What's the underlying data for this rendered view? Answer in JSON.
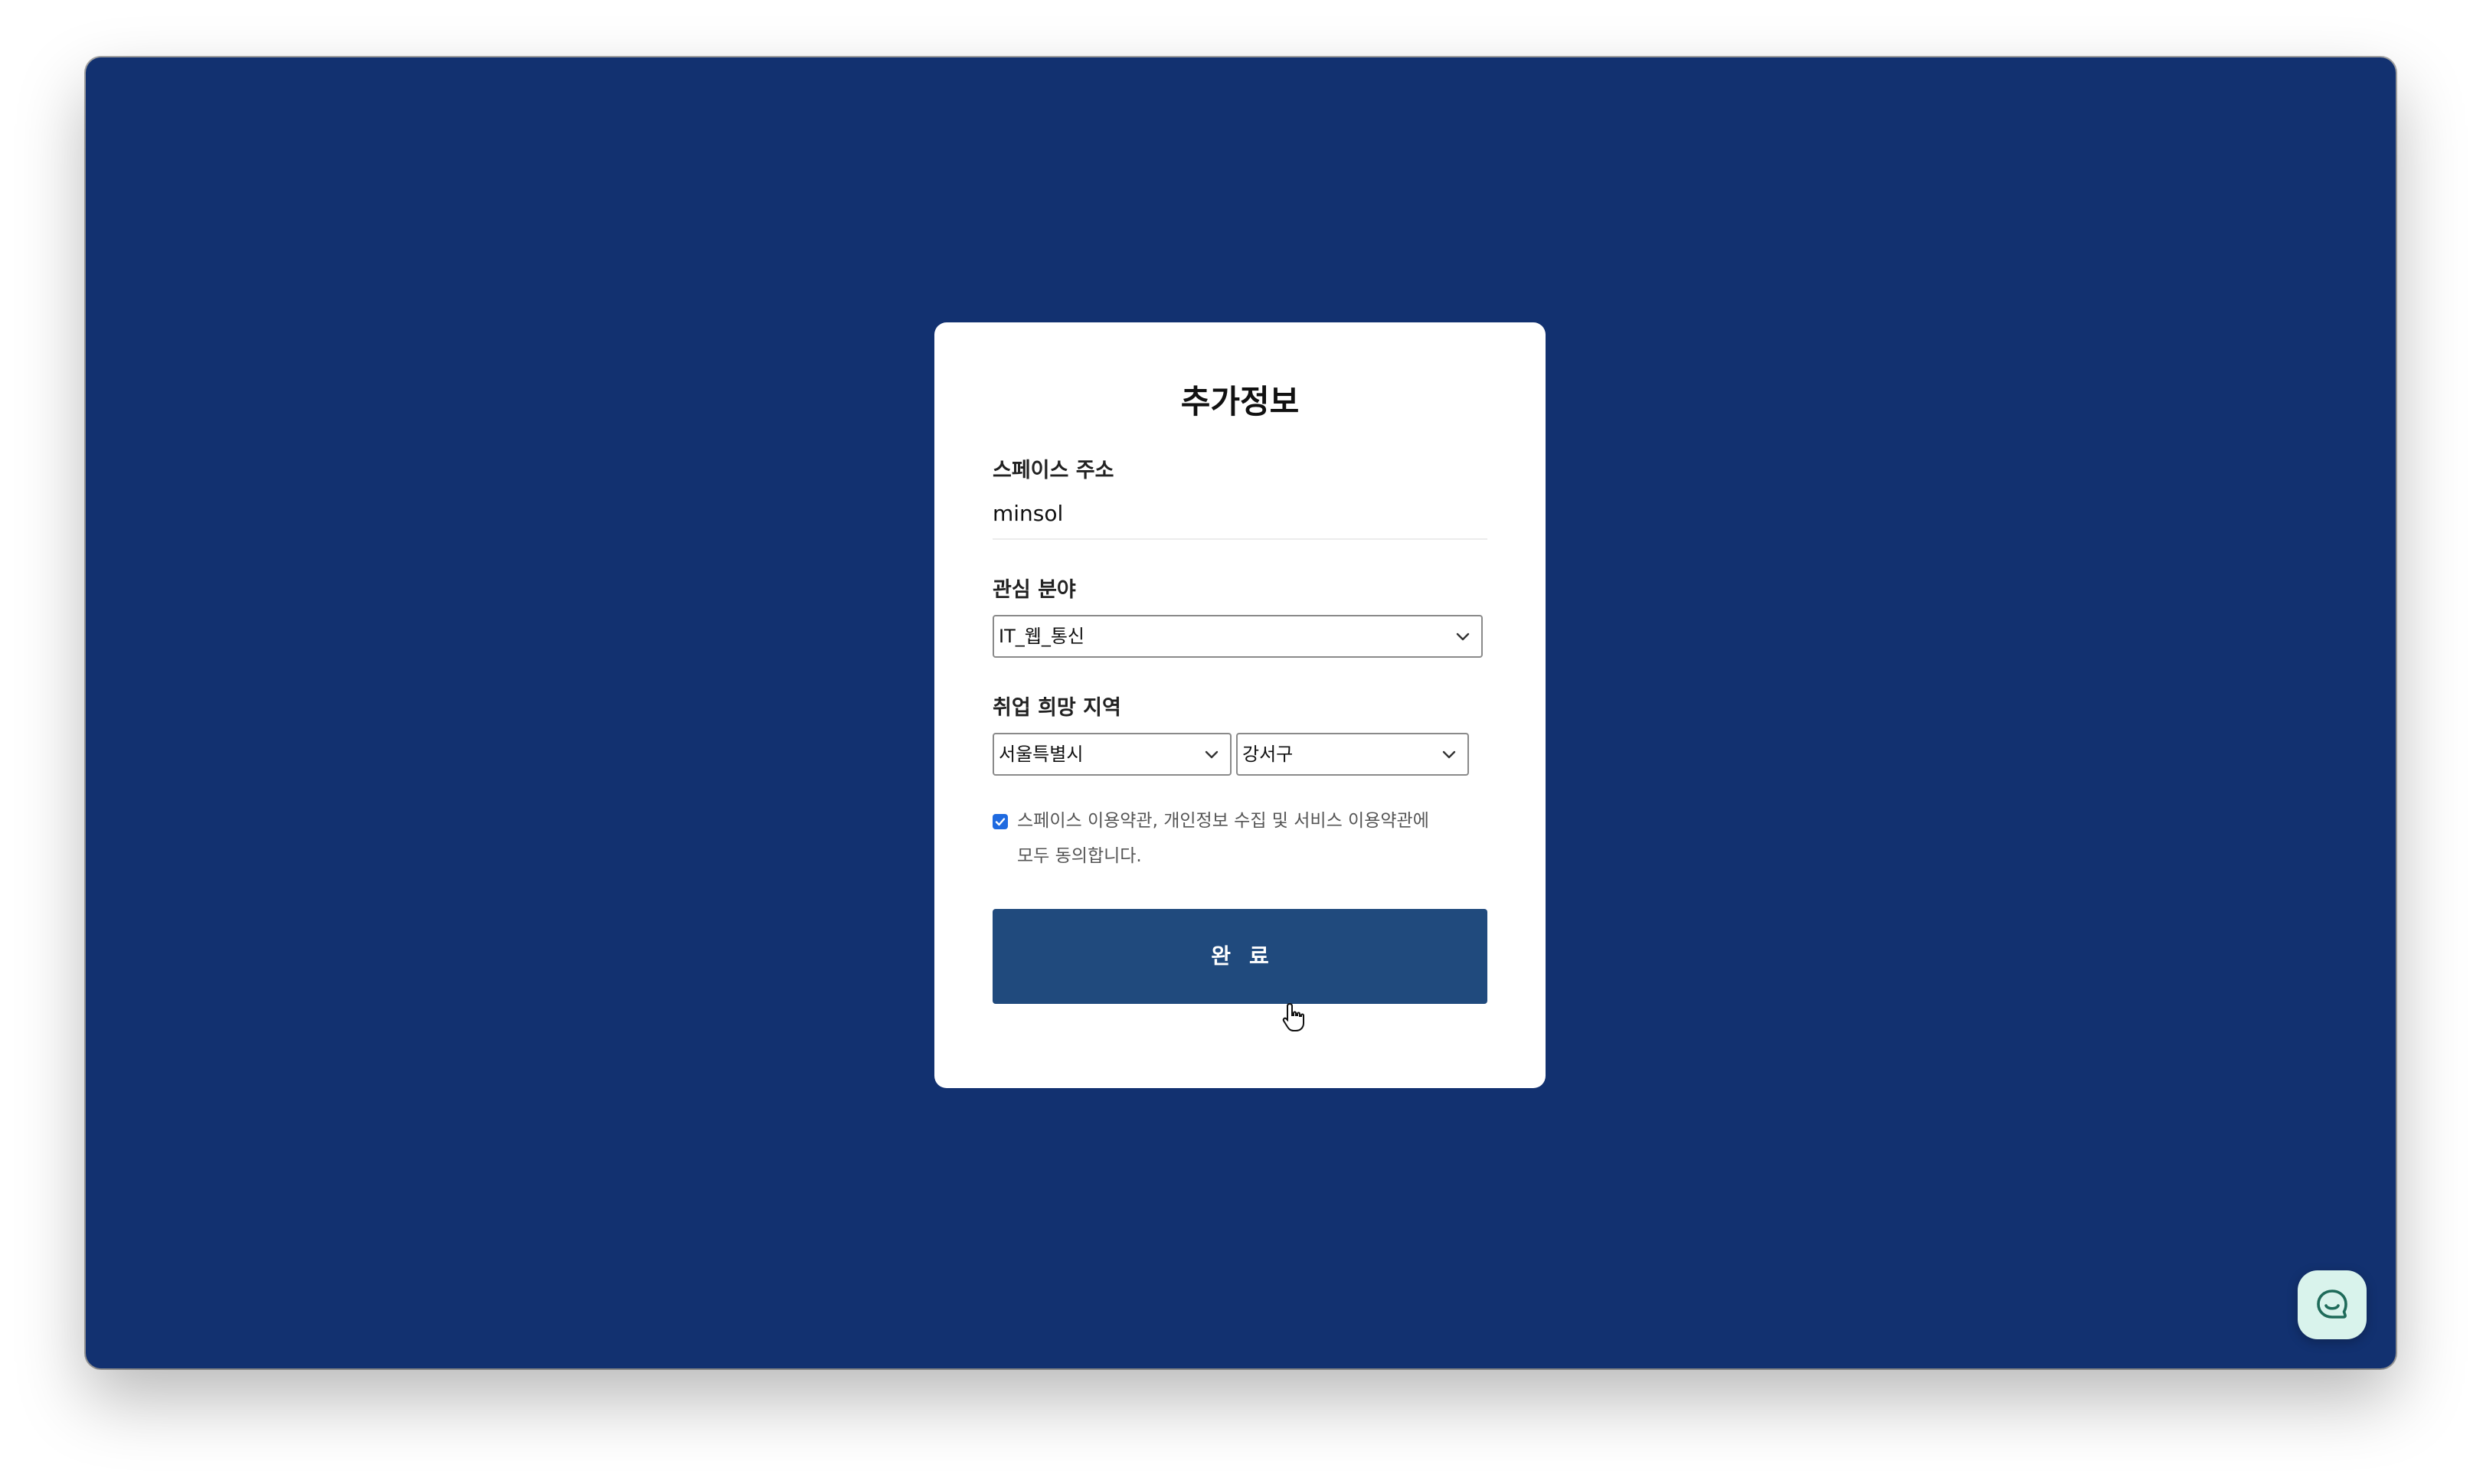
{
  "form": {
    "title": "추가정보",
    "space_address": {
      "label": "스페이스 주소",
      "value": "minsol"
    },
    "interest": {
      "label": "관심 분야",
      "selected": "IT_웹_통신"
    },
    "region": {
      "label": "취업 희망 지역",
      "city_selected": "서울특별시",
      "district_selected": "강서구"
    },
    "agreement": {
      "checked": true,
      "text_line1": "스페이스 이용약관, 개인정보 수집 및 서비스 이용약관에",
      "text_line2": "모두 동의합니다."
    },
    "submit_label": "완료"
  },
  "icons": {
    "select_arrow": "chevron-down-icon",
    "checkbox_mark": "checkmark-icon",
    "cursor": "hand-pointer-cursor-icon",
    "chat": "chat-bubble-icon"
  },
  "colors": {
    "background": "#123170",
    "card": "#ffffff",
    "submit_button": "#204a7d",
    "checkbox": "#1f6ae0",
    "chat_button": "#d9f3ec",
    "chat_icon": "#1f6b5a"
  }
}
